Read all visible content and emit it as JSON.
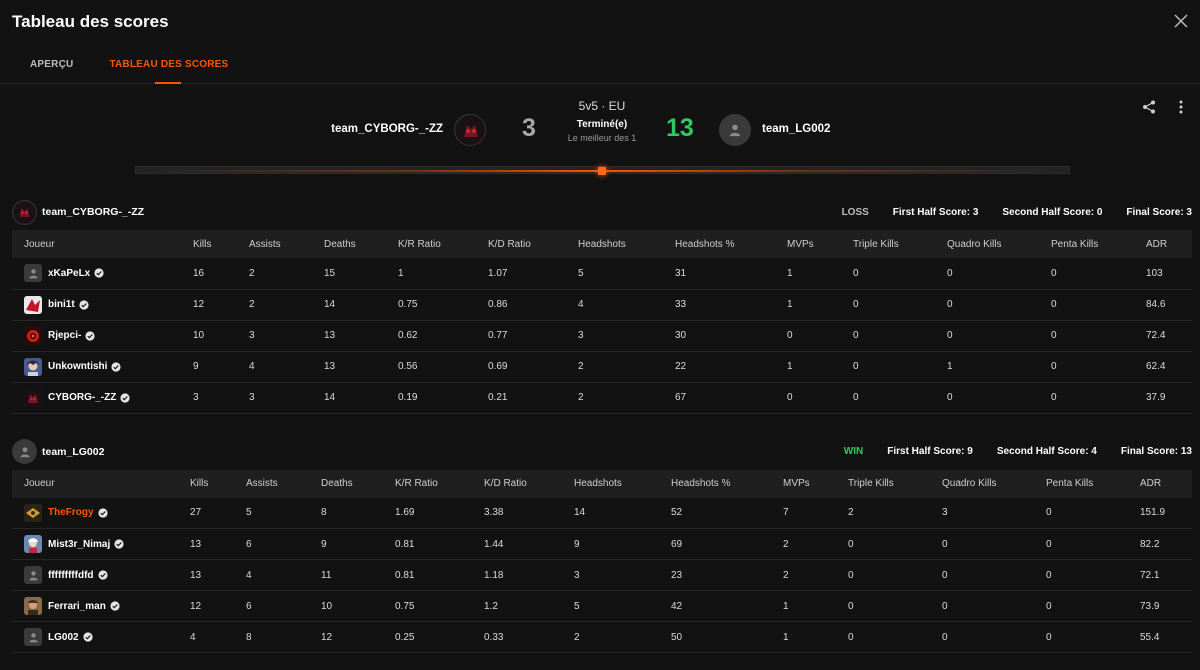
{
  "window": {
    "title": "Tableau des scores"
  },
  "tabs": [
    {
      "label": "APERÇU"
    },
    {
      "label": "TABLEAU DES SCORES"
    }
  ],
  "match": {
    "mode": "5v5 · EU",
    "status": "Terminé(e)",
    "best_of": "Le meilleur des 1",
    "left_team": {
      "name": "team_CYBORG-_-ZZ",
      "score": "3"
    },
    "right_team": {
      "name": "team_LG002",
      "score": "13"
    },
    "progress": 0.5
  },
  "colors": {
    "accent": "#ff5500",
    "win": "#32c864",
    "loss": "#a8a8a8",
    "background": "#121212"
  },
  "columns": [
    "Joueur",
    "Kills",
    "Assists",
    "Deaths",
    "K/R Ratio",
    "K/D Ratio",
    "Headshots",
    "Headshots %",
    "MVPs",
    "Triple Kills",
    "Quadro Kills",
    "Penta Kills",
    "ADR"
  ],
  "teams": [
    {
      "name": "team_CYBORG-_-ZZ",
      "result": "LOSS",
      "first_half": "First Half Score: 3",
      "second_half": "Second Half Score: 0",
      "final": "Final Score: 3",
      "players": [
        {
          "name": "xKaPeLx",
          "avatar": "default-avatar-icon",
          "stats": [
            "16",
            "2",
            "15",
            "1",
            "1.07",
            "5",
            "31",
            "1",
            "0",
            "0",
            "0",
            "103"
          ]
        },
        {
          "name": "bini1t",
          "avatar": "red-white-avatar",
          "stats": [
            "12",
            "2",
            "14",
            "0.75",
            "0.86",
            "4",
            "33",
            "1",
            "0",
            "0",
            "0",
            "84.6"
          ]
        },
        {
          "name": "Rjepci-",
          "avatar": "red-emblem-avatar",
          "stats": [
            "10",
            "3",
            "13",
            "0.62",
            "0.77",
            "3",
            "30",
            "0",
            "0",
            "0",
            "0",
            "72.4"
          ]
        },
        {
          "name": "Unkowntishi",
          "avatar": "anime-avatar",
          "stats": [
            "9",
            "4",
            "13",
            "0.56",
            "0.69",
            "2",
            "22",
            "1",
            "0",
            "1",
            "0",
            "62.4"
          ]
        },
        {
          "name": "CYBORG-_-ZZ",
          "avatar": "cyborg-avatar",
          "stats": [
            "3",
            "3",
            "14",
            "0.19",
            "0.21",
            "2",
            "67",
            "0",
            "0",
            "0",
            "0",
            "37.9"
          ]
        }
      ]
    },
    {
      "name": "team_LG002",
      "result": "WIN",
      "first_half": "First Half Score: 9",
      "second_half": "Second Half Score: 4",
      "final": "Final Score: 13",
      "players": [
        {
          "name": "TheFrogy",
          "avatar": "gold-emblem-avatar",
          "highlight": true,
          "stats": [
            "27",
            "5",
            "8",
            "1.69",
            "3.38",
            "14",
            "52",
            "7",
            "2",
            "3",
            "0",
            "151.9"
          ]
        },
        {
          "name": "Mist3r_Nimaj",
          "avatar": "character-avatar",
          "stats": [
            "13",
            "6",
            "9",
            "0.81",
            "1.44",
            "9",
            "69",
            "2",
            "0",
            "0",
            "0",
            "82.2"
          ]
        },
        {
          "name": "fffffffffdfd",
          "avatar": "default-avatar-icon",
          "stats": [
            "13",
            "4",
            "11",
            "0.81",
            "1.18",
            "3",
            "23",
            "2",
            "0",
            "0",
            "0",
            "72.1"
          ]
        },
        {
          "name": "Ferrari_man",
          "avatar": "portrait-avatar",
          "stats": [
            "12",
            "6",
            "10",
            "0.75",
            "1.2",
            "5",
            "42",
            "1",
            "0",
            "0",
            "0",
            "73.9"
          ]
        },
        {
          "name": "LG002",
          "avatar": "default-avatar-icon",
          "stats": [
            "4",
            "8",
            "12",
            "0.25",
            "0.33",
            "2",
            "50",
            "1",
            "0",
            "0",
            "0",
            "55.4"
          ]
        }
      ]
    }
  ]
}
